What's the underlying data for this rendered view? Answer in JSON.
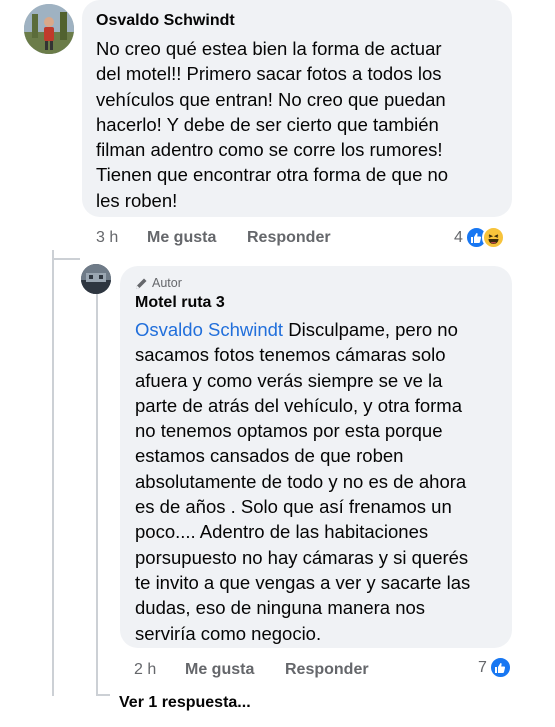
{
  "comment": {
    "author": "Osvaldo Schwindt",
    "lines": [
      "No creo qué estea bien la forma de actuar",
      "del motel!! Primero sacar fotos a todos los",
      "vehículos que entran! No creo que puedan",
      "hacerlo! Y debe de ser cierto que también",
      "filman adentro como se corre los rumores!",
      "Tienen que encontrar otra forma de que no",
      "les roben!"
    ],
    "time": "3 h",
    "like_label": "Me gusta",
    "reply_label": "Responder",
    "reaction_count": "4",
    "reaction_icons": [
      "like-icon",
      "haha-icon"
    ]
  },
  "reply": {
    "badge": "Autor",
    "author": "Motel ruta 3",
    "mention": "Osvaldo Schwindt",
    "first_line_rest": " Disculpame, pero no",
    "lines": [
      "sacamos fotos tenemos cámaras solo",
      "afuera y como verás siempre se ve la",
      "parte de atrás del vehículo, y otra forma",
      "no tenemos optamos por esta porque",
      "estamos cansados de que roben",
      "absolutamente de todo y no es de ahora",
      "es de años . Solo que así frenamos un",
      "poco.... Adentro de las habitaciones",
      "porsupuesto no hay cámaras y si querés",
      "te invito a que vengas a ver y sacarte las",
      "dudas, eso de ninguna manera nos",
      "serviría como negocio."
    ],
    "time": "2 h",
    "like_label": "Me gusta",
    "reply_label": "Responder",
    "reaction_count": "7",
    "reaction_icons": [
      "like-icon"
    ]
  },
  "view_more": "Ver 1 respuesta...",
  "colors": {
    "bubble": "#f0f2f5",
    "link": "#216fdb",
    "like": "#1877f2",
    "haha": "#f7c33b",
    "secondary_text": "#65676b"
  }
}
